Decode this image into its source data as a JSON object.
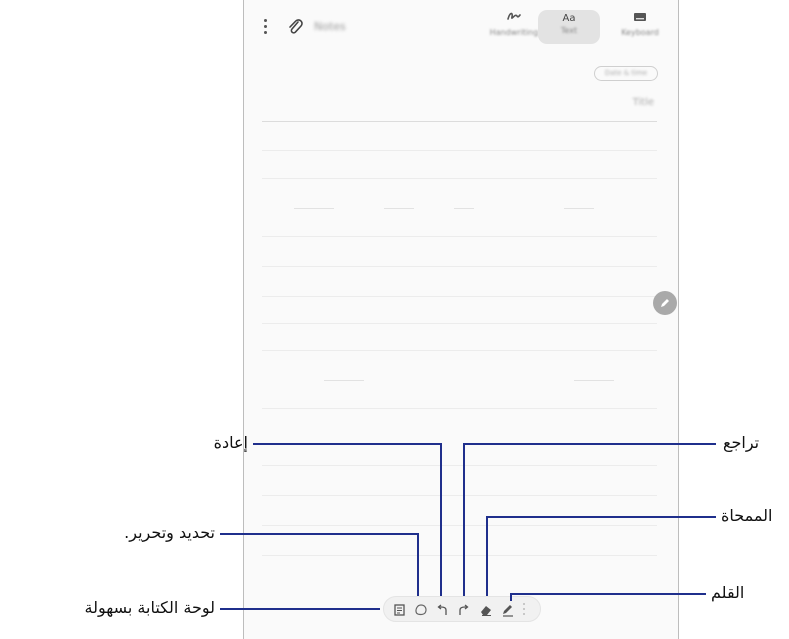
{
  "toolbar": {
    "title": "Notes",
    "modes": [
      {
        "label": "Handwriting",
        "icon": "handwriting-icon"
      },
      {
        "label": "Text",
        "glyph": "Aa"
      },
      {
        "label": "Keyboard",
        "icon": "keyboard-icon"
      }
    ]
  },
  "note": {
    "date": "Date & time",
    "title_placeholder": "Title"
  },
  "pen_toolbar": {
    "tools": [
      "easy-writing-pad-icon",
      "selection-icon",
      "undo-icon",
      "redo-icon",
      "eraser-icon",
      "pen-icon",
      "more-icon"
    ]
  },
  "callouts": {
    "redo": "إعادة",
    "selection": "تحديد وتحرير.",
    "easy_writing_pad": "لوحة الكتابة بسهولة",
    "undo": "تراجع",
    "eraser": "الممحاة",
    "pen": "القلم"
  },
  "colors": {
    "callout_line": "#1f2f8c",
    "tablet_bg": "#fafafa"
  }
}
